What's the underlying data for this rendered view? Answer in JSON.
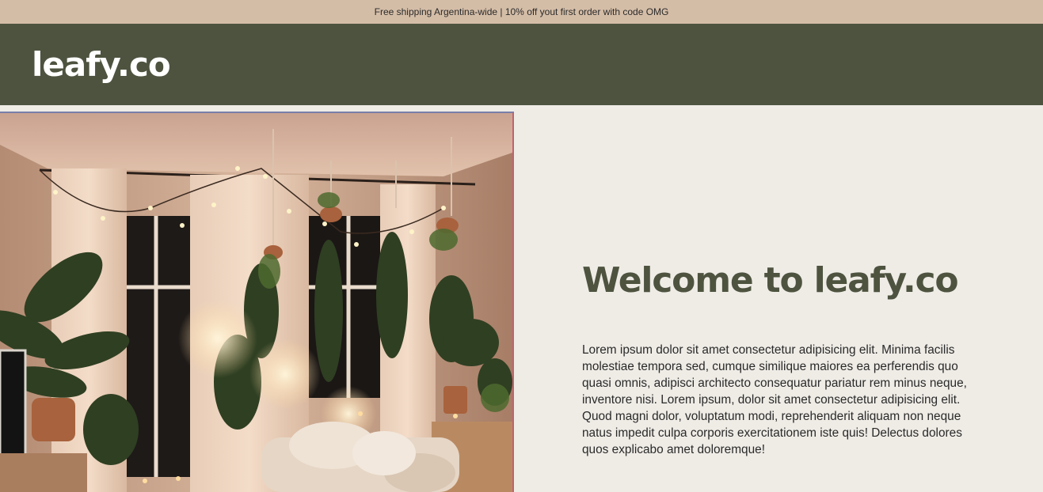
{
  "announcement": {
    "text": "Free shipping Argentina-wide | 10% off yout first order with code OMG"
  },
  "header": {
    "logo": "leafy.co"
  },
  "hero": {
    "image_alt": "cozy-living-room-with-hanging-plants",
    "title": "Welcome to leafy.co",
    "body": "Lorem ipsum dolor sit amet consectetur adipisicing elit. Minima facilis molestiae tempora sed, cumque similique maiores ea perferendis quo quasi omnis, adipisci architecto consequatur pariatur rem minus neque, inventore nisi. Lorem ipsum, dolor sit amet consectetur adipisicing elit. Quod magni dolor, voluptatum modi, reprehenderit aliquam non neque natus impedit culpa corporis exercitationem iste quis! Delectus dolores quos explicabo amet doloremque!"
  },
  "colors": {
    "announcement_bg": "#d4bda7",
    "header_bg": "#4d533f",
    "page_bg": "#efece6",
    "title_color": "#4d533f"
  }
}
